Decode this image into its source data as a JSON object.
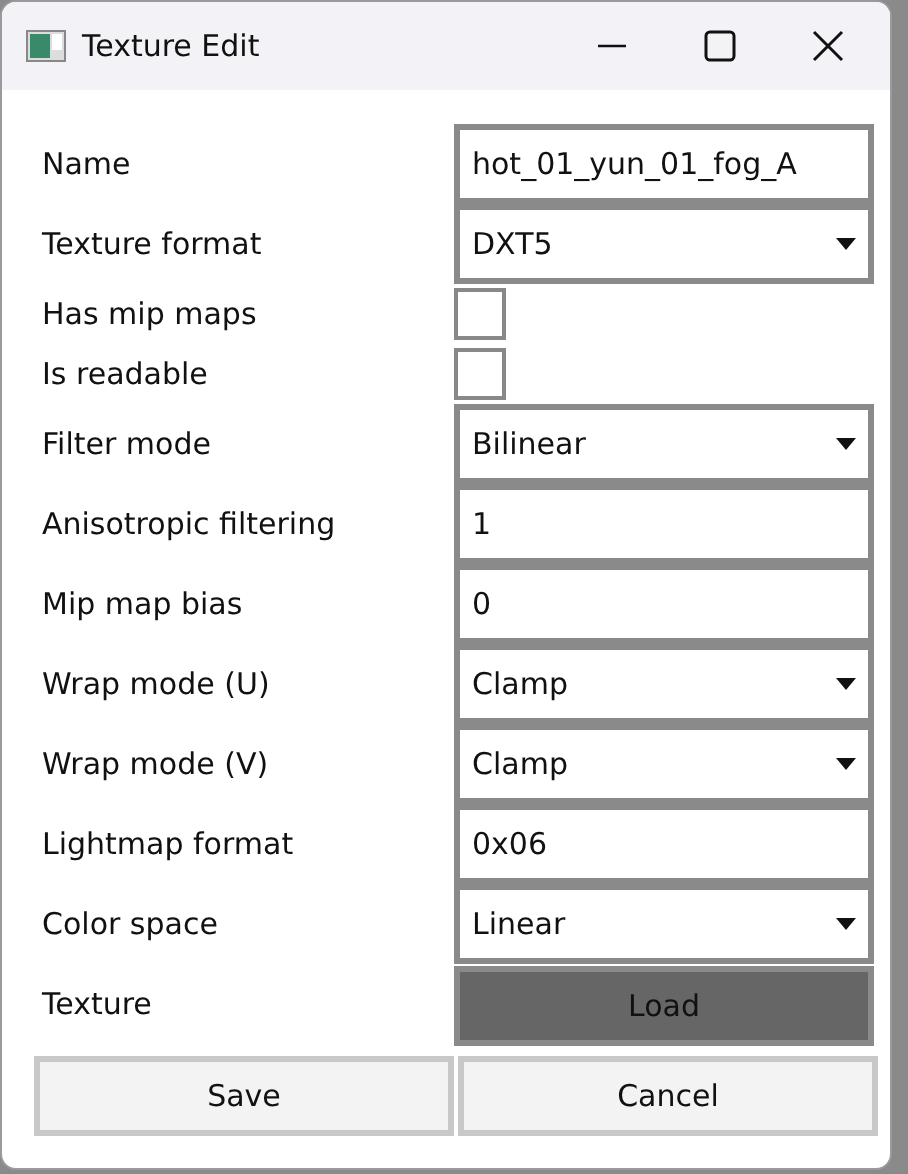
{
  "window": {
    "title": "Texture Edit"
  },
  "fields": [
    {
      "label": "Name",
      "kind": "text",
      "value": "hot_01_yun_01_fog_A"
    },
    {
      "label": "Texture format",
      "kind": "dropdown",
      "value": "DXT5"
    },
    {
      "label": "Has mip maps",
      "kind": "checkbox",
      "checked": false
    },
    {
      "label": "Is readable",
      "kind": "checkbox",
      "checked": false
    },
    {
      "label": "Filter mode",
      "kind": "dropdown",
      "value": "Bilinear"
    },
    {
      "label": "Anisotropic filtering",
      "kind": "text",
      "value": "1"
    },
    {
      "label": "Mip map bias",
      "kind": "text",
      "value": "0"
    },
    {
      "label": "Wrap mode (U)",
      "kind": "dropdown",
      "value": "Clamp"
    },
    {
      "label": "Wrap mode (V)",
      "kind": "dropdown",
      "value": "Clamp"
    },
    {
      "label": "Lightmap format",
      "kind": "text",
      "value": "0x06"
    },
    {
      "label": "Color space",
      "kind": "dropdown",
      "value": "Linear"
    },
    {
      "label": "Texture",
      "kind": "button",
      "value": "Load"
    }
  ],
  "buttons": [
    "Save",
    "Cancel"
  ]
}
